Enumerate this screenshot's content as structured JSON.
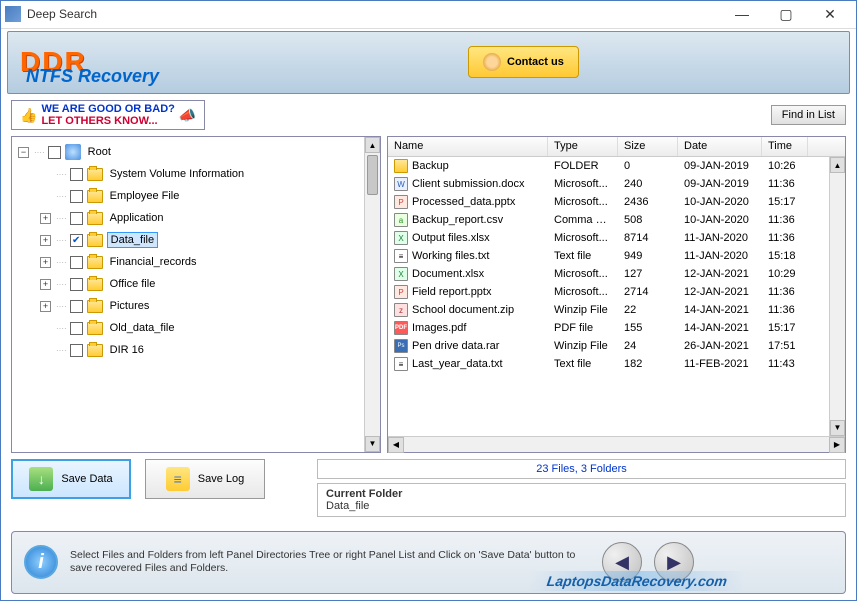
{
  "window": {
    "title": "Deep Search"
  },
  "header": {
    "logo": "DDR",
    "product": "NTFS Recovery",
    "contact_label": "Contact us"
  },
  "promo": {
    "line1": "WE ARE GOOD OR BAD?",
    "line2": "LET OTHERS KNOW..."
  },
  "find_in_list": "Find in List",
  "tree": {
    "root_label": "Root",
    "nodes": [
      {
        "label": "System Volume Information",
        "expandable": false
      },
      {
        "label": "Employee File",
        "expandable": false
      },
      {
        "label": "Application",
        "expandable": true
      },
      {
        "label": "Data_file",
        "expandable": true,
        "checked": true,
        "selected": true
      },
      {
        "label": "Financial_records",
        "expandable": true
      },
      {
        "label": "Office file",
        "expandable": true
      },
      {
        "label": "Pictures",
        "expandable": true
      },
      {
        "label": "Old_data_file",
        "expandable": false
      },
      {
        "label": "DIR 16",
        "expandable": false
      }
    ]
  },
  "list": {
    "columns": {
      "name": "Name",
      "type": "Type",
      "size": "Size",
      "date": "Date",
      "time": "Time"
    },
    "rows": [
      {
        "ico": "folder",
        "name": "Backup",
        "type": "FOLDER",
        "size": "0",
        "date": "09-JAN-2019",
        "time": "10:26"
      },
      {
        "ico": "doc",
        "name": "Client submission.docx",
        "type": "Microsoft...",
        "size": "240",
        "date": "09-JAN-2019",
        "time": "11:36"
      },
      {
        "ico": "ppt",
        "name": "Processed_data.pptx",
        "type": "Microsoft...",
        "size": "2436",
        "date": "10-JAN-2020",
        "time": "15:17"
      },
      {
        "ico": "csv",
        "name": "Backup_report.csv",
        "type": "Comma S...",
        "size": "508",
        "date": "10-JAN-2020",
        "time": "11:36"
      },
      {
        "ico": "xls",
        "name": "Output files.xlsx",
        "type": "Microsoft...",
        "size": "8714",
        "date": "11-JAN-2020",
        "time": "11:36"
      },
      {
        "ico": "txt",
        "name": "Working files.txt",
        "type": "Text file",
        "size": "949",
        "date": "11-JAN-2020",
        "time": "15:18"
      },
      {
        "ico": "xls",
        "name": "Document.xlsx",
        "type": "Microsoft...",
        "size": "127",
        "date": "12-JAN-2021",
        "time": "10:29"
      },
      {
        "ico": "ppt",
        "name": "Field report.pptx",
        "type": "Microsoft...",
        "size": "2714",
        "date": "12-JAN-2021",
        "time": "11:36"
      },
      {
        "ico": "zip",
        "name": "School document.zip",
        "type": "Winzip File",
        "size": "22",
        "date": "14-JAN-2021",
        "time": "11:36"
      },
      {
        "ico": "pdf",
        "name": "Images.pdf",
        "type": "PDF file",
        "size": "155",
        "date": "14-JAN-2021",
        "time": "15:17"
      },
      {
        "ico": "rar",
        "name": "Pen drive data.rar",
        "type": "Winzip File",
        "size": "24",
        "date": "26-JAN-2021",
        "time": "17:51"
      },
      {
        "ico": "txt",
        "name": "Last_year_data.txt",
        "type": "Text file",
        "size": "182",
        "date": "11-FEB-2021",
        "time": "11:43"
      }
    ]
  },
  "buttons": {
    "save_data": "Save Data",
    "save_log": "Save Log"
  },
  "summary": {
    "count": "23 Files, 3 Folders",
    "current_folder_label": "Current Folder",
    "current_folder_value": "Data_file"
  },
  "footer": {
    "hint": "Select Files and Folders from left Panel Directories Tree or right Panel List and Click on 'Save Data' button to save recovered Files and Folders.",
    "watermark": "LaptopsDataRecovery.com"
  }
}
